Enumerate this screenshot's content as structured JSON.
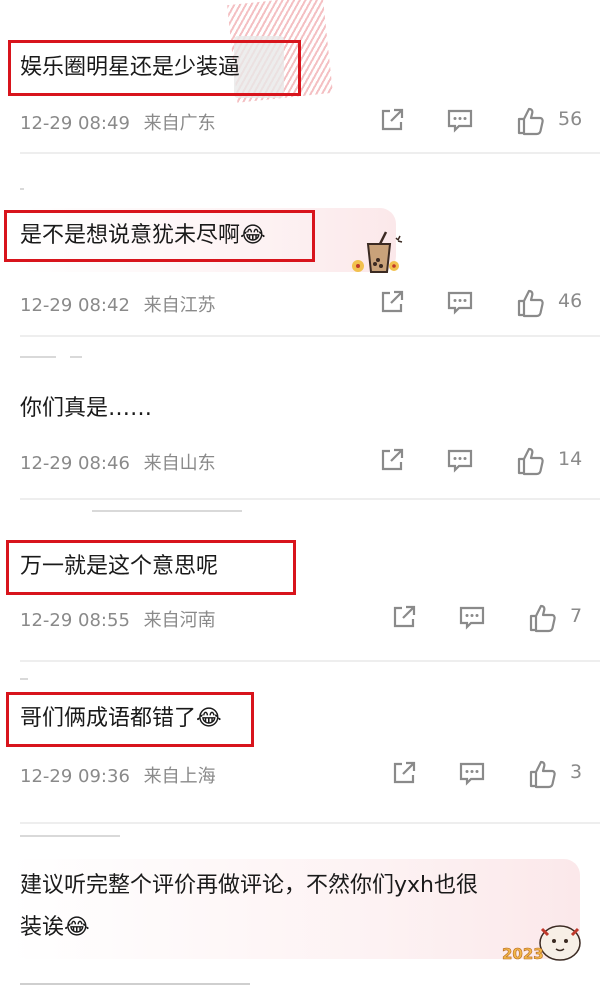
{
  "comments": [
    {
      "text": "娱乐圈明星还是少装逼",
      "time": "12-29 08:49",
      "location": "来自广东",
      "likes": "56"
    },
    {
      "text": "是不是想说意犹未尽啊",
      "emoji": "😂",
      "time": "12-29 08:42",
      "location": "来自江苏",
      "likes": "46"
    },
    {
      "text": "你们真是……",
      "time": "12-29 08:46",
      "location": "来自山东",
      "likes": "14"
    },
    {
      "text": "万一就是这个意思呢",
      "time": "12-29 08:55",
      "location": "来自河南",
      "likes": "7"
    },
    {
      "text": "哥们俩成语都错了",
      "emoji": "😂",
      "time": "12-29 09:36",
      "location": "来自上海",
      "likes": "3"
    },
    {
      "line1": "建议听完整个评价再做评论，不然你们yxh也很",
      "line2": "装诶",
      "emoji": "😂"
    }
  ],
  "stickers": {
    "badge_2023": "2023"
  }
}
